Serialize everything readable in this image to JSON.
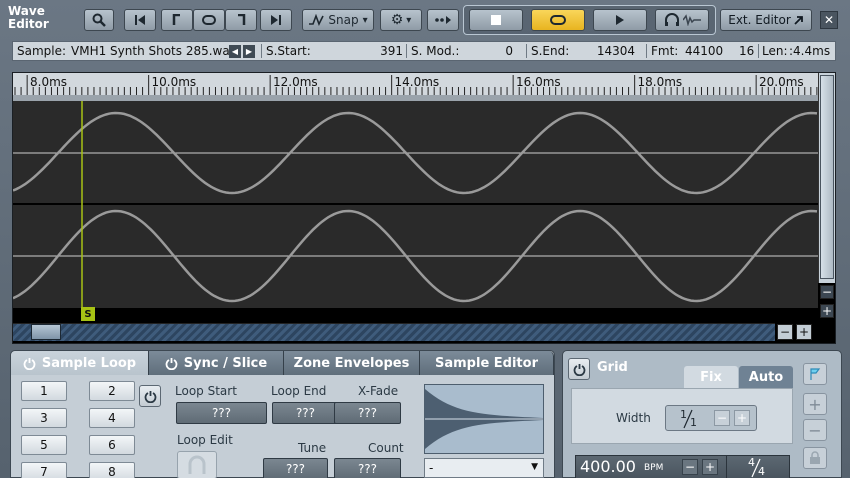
{
  "window": {
    "title_line1": "Wave",
    "title_line2": "Editor"
  },
  "toolbar": {
    "snap_label": "Snap",
    "ext_editor_label": "Ext. Editor",
    "close_glyph": "✕",
    "gear_caret": "▾",
    "snap_caret": "▾",
    "colors": {
      "loop_active": "#f2c230",
      "button": "#a7b3be"
    }
  },
  "info": {
    "sample_label": "Sample:",
    "sample_name": "VMH1 Synth Shots 285.wa",
    "sstart_label": "S.Start:",
    "sstart_value": "391",
    "smod_label": "S. Mod.:",
    "smod_value": "0",
    "send_label": "S.End:",
    "send_value": "14304",
    "fmt_label": "Fmt:",
    "fmt_rate": "44100",
    "fmt_bits": "16",
    "len_label": "Len:",
    "len_value": ":4.4ms"
  },
  "ruler": {
    "ticks": [
      "8.0ms",
      "10.0ms",
      "12.0ms",
      "14.0ms",
      "16.0ms",
      "18.0ms",
      "20.0ms"
    ]
  },
  "waveform": {
    "marker_label": "S",
    "marker_color": "#a7c214"
  },
  "scroll": {
    "minus": "−",
    "plus": "+"
  },
  "tabs": [
    {
      "label": "Sample Loop"
    },
    {
      "label": "Sync / Slice"
    },
    {
      "label": "Zone Envelopes"
    },
    {
      "label": "Sample Editor"
    }
  ],
  "loop_slots": [
    "1",
    "2",
    "3",
    "4",
    "5",
    "6",
    "7",
    "8"
  ],
  "loop": {
    "loop_start_label": "Loop Start",
    "loop_end_label": "Loop End",
    "xfade_label": "X-Fade",
    "loop_edit_label": "Loop Edit",
    "tune_label": "Tune",
    "count_label": "Count",
    "loop_start_value": "???",
    "loop_end_value": "???",
    "xfade_value": "???",
    "tune_value": "???",
    "count_value": "???",
    "dropdown_value": "-"
  },
  "grid": {
    "title": "Grid",
    "fix_tab": "Fix",
    "auto_tab": "Auto",
    "width_label": "Width",
    "fraction_num": "1",
    "fraction_den": "1",
    "bpm_value": "400.00",
    "bpm_unit": "BPM",
    "meter_num": "4",
    "meter_den": "4",
    "minus": "−",
    "plus": "+"
  }
}
